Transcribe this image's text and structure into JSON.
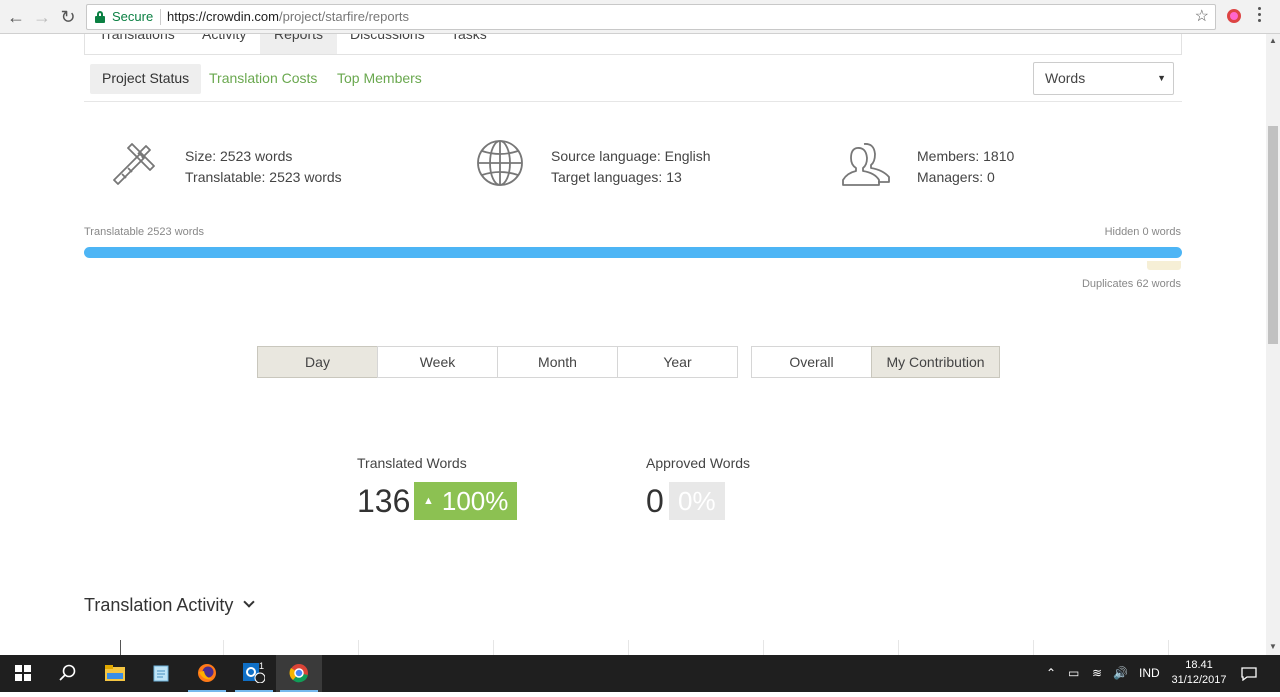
{
  "browser": {
    "secure_label": "Secure",
    "url_host": "https://crowdin.com",
    "url_path": "/project/starfire/reports"
  },
  "main_tabs": [
    "Translations",
    "Activity",
    "Reports",
    "Discussions",
    "Tasks"
  ],
  "sub_tabs": [
    "Project Status",
    "Translation Costs",
    "Top Members"
  ],
  "unit_select": {
    "value": "Words"
  },
  "stats": {
    "size": "Size: 2523 words",
    "translatable": "Translatable: 2523 words",
    "source_language": "Source language: English",
    "target_languages": "Target languages: 13",
    "members": "Members: 1810",
    "managers": "Managers: 0"
  },
  "progress": {
    "translatable_label": "Translatable 2523 words",
    "hidden_label": "Hidden 0 words",
    "duplicates_label": "Duplicates 62 words"
  },
  "periods": [
    "Day",
    "Week",
    "Month",
    "Year"
  ],
  "scope": [
    "Overall",
    "My Contribution"
  ],
  "metrics": {
    "translated": {
      "label": "Translated Words",
      "value": "136",
      "change": "100%"
    },
    "approved": {
      "label": "Approved Words",
      "value": "0",
      "change": "0%"
    }
  },
  "activity": {
    "title": "Translation Activity"
  },
  "taskbar": {
    "lang": "IND",
    "time": "18.41",
    "date": "31/12/2017",
    "mail_badge": "1"
  },
  "colors": {
    "accent_green": "#8cc152",
    "link_green": "#6aa84f",
    "progress_blue": "#4db5f5",
    "secure_green": "#0b8043"
  }
}
